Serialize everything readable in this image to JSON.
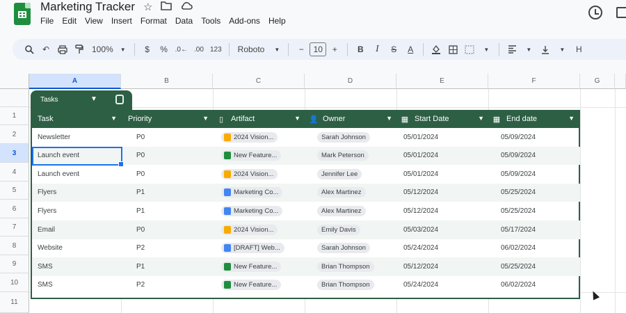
{
  "app": {
    "title": "Marketing Tracker",
    "menu": [
      "File",
      "Edit",
      "View",
      "Insert",
      "Format",
      "Data",
      "Tools",
      "Add-ons",
      "Help"
    ]
  },
  "toolbar": {
    "zoom": "100%",
    "currency": "$",
    "percent": "%",
    "number_format": "123",
    "font": "Roboto",
    "font_size": "10",
    "minus": "−",
    "plus": "+",
    "bold": "B",
    "italic": "I",
    "strike": "S",
    "text_color": "A",
    "more": "H"
  },
  "grid": {
    "columns": [
      "A",
      "B",
      "C",
      "D",
      "E",
      "F",
      "G"
    ],
    "rows": [
      "",
      "1",
      "2",
      "3",
      "4",
      "5",
      "6",
      "7",
      "8",
      "9",
      "10",
      "11"
    ]
  },
  "table": {
    "name": "Tasks",
    "headers": [
      "Task",
      "Priority",
      "Artifact",
      "Owner",
      "Start Date",
      "End date"
    ],
    "rows": [
      {
        "task": "Newsletter",
        "priority": "P0",
        "artifact": "2024 Vision...",
        "artifact_type": "slides",
        "owner": "Sarah Johnson",
        "start": "05/01/2024",
        "end": "05/09/2024"
      },
      {
        "task": "Launch event",
        "priority": "P0",
        "artifact": "New Feature...",
        "artifact_type": "sheets",
        "owner": "Mark Peterson",
        "start": "05/01/2024",
        "end": "05/09/2024"
      },
      {
        "task": "Launch event",
        "priority": "P0",
        "artifact": "2024 Vision...",
        "artifact_type": "slides",
        "owner": "Jennifer Lee",
        "start": "05/01/2024",
        "end": "05/09/2024"
      },
      {
        "task": "Flyers",
        "priority": "P1",
        "artifact": "Marketing Co...",
        "artifact_type": "docs",
        "owner": "Alex Martinez",
        "start": "05/12/2024",
        "end": "05/25/2024"
      },
      {
        "task": "Flyers",
        "priority": "P1",
        "artifact": "Marketing Co...",
        "artifact_type": "docs",
        "owner": "Alex Martinez",
        "start": "05/12/2024",
        "end": "05/25/2024"
      },
      {
        "task": "Email",
        "priority": "P0",
        "artifact": "2024 Vision...",
        "artifact_type": "slides",
        "owner": "Emily Davis",
        "start": "05/03/2024",
        "end": "05/17/2024"
      },
      {
        "task": "Website",
        "priority": "P2",
        "artifact": "[DRAFT] Web...",
        "artifact_type": "docs",
        "owner": "Sarah Johnson",
        "start": "05/24/2024",
        "end": "06/02/2024"
      },
      {
        "task": "SMS",
        "priority": "P1",
        "artifact": "New Feature...",
        "artifact_type": "sheets",
        "owner": "Brian Thompson",
        "start": "05/12/2024",
        "end": "05/25/2024"
      },
      {
        "task": "SMS",
        "priority": "P2",
        "artifact": "New Feature...",
        "artifact_type": "sheets",
        "owner": "Brian Thompson",
        "start": "05/24/2024",
        "end": "06/02/2024"
      }
    ]
  },
  "colors": {
    "table_header": "#2d5f44",
    "selection": "#1a73e8"
  }
}
